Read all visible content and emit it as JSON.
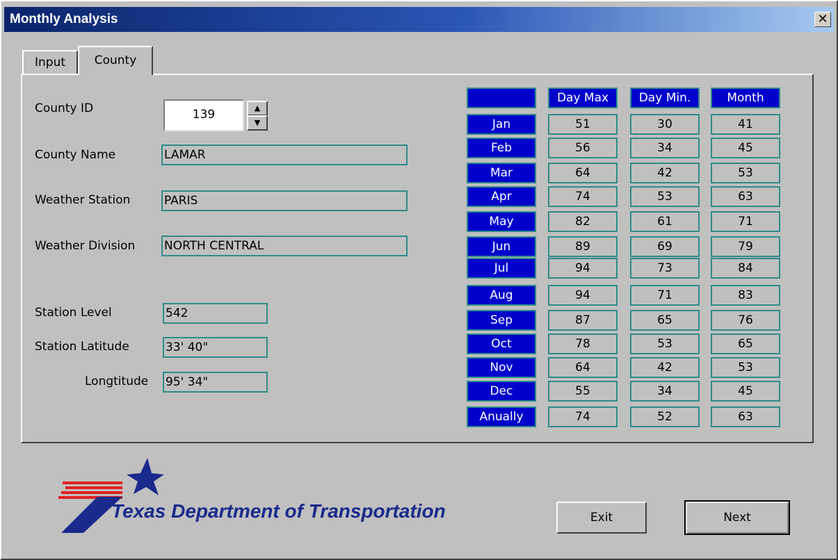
{
  "window": {
    "title": "Monthly Analysis",
    "close_label": "✕"
  },
  "tabs": [
    {
      "label": "Input",
      "active": false
    },
    {
      "label": "County",
      "active": true
    }
  ],
  "form": {
    "county_id_label": "County ID",
    "county_id_value": "139",
    "county_name_label": "County Name",
    "county_name_value": "LAMAR",
    "weather_station_label": "Weather Station",
    "weather_station_value": "PARIS",
    "weather_division_label": "Weather Division",
    "weather_division_value": "NORTH CENTRAL",
    "station_level_label": "Station Level",
    "station_level_value": "542",
    "station_latitude_label": "Station Latitude",
    "station_latitude_value": "33' 40\"",
    "longitude_label": "Longtitude",
    "longitude_value": "95' 34\""
  },
  "table": {
    "headers": [
      "",
      "Day Max",
      "Day Min.",
      "Month"
    ],
    "rows": [
      {
        "month": "Jan",
        "day_max": "51",
        "day_min": "30",
        "month_avg": "41"
      },
      {
        "month": "Feb",
        "day_max": "56",
        "day_min": "34",
        "month_avg": "45"
      },
      {
        "month": "Mar",
        "day_max": "64",
        "day_min": "42",
        "month_avg": "53"
      },
      {
        "month": "Apr",
        "day_max": "74",
        "day_min": "53",
        "month_avg": "63"
      },
      {
        "month": "May",
        "day_max": "82",
        "day_min": "61",
        "month_avg": "71"
      },
      {
        "month": "Jun",
        "day_max": "89",
        "day_min": "69",
        "month_avg": "79"
      },
      {
        "month": "Jul",
        "day_max": "94",
        "day_min": "73",
        "month_avg": "84"
      },
      {
        "month": "Aug",
        "day_max": "94",
        "day_min": "71",
        "month_avg": "83"
      },
      {
        "month": "Sep",
        "day_max": "87",
        "day_min": "65",
        "month_avg": "76"
      },
      {
        "month": "Oct",
        "day_max": "78",
        "day_min": "53",
        "month_avg": "65"
      },
      {
        "month": "Nov",
        "day_max": "64",
        "day_min": "42",
        "month_avg": "53"
      },
      {
        "month": "Dec",
        "day_max": "55",
        "day_min": "34",
        "month_avg": "45"
      },
      {
        "month": "Anually",
        "day_max": "74",
        "day_min": "52",
        "month_avg": "63"
      }
    ]
  },
  "logo": {
    "text": "Texas Department of Transportation",
    "icon": "txdot-star-logo-icon"
  },
  "buttons": {
    "exit_label": "Exit",
    "next_label": "Next"
  },
  "colors": {
    "header_blue": "#0000cc",
    "cell_border": "#2e8b8b",
    "logo_navy": "#1a2a8c",
    "logo_red": "#e02020"
  }
}
